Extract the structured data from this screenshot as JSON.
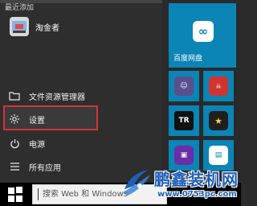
{
  "start_menu": {
    "recently_added_title": "最近添加",
    "recent_app": {
      "label": "淘金者",
      "icon": "game-app-icon"
    },
    "items": [
      {
        "label": "文件资源管理器",
        "icon": "folder-icon",
        "has_arrow": true
      },
      {
        "label": "设置",
        "icon": "gear-icon",
        "highlighted": true
      },
      {
        "label": "电源",
        "icon": "power-icon"
      },
      {
        "label": "所有应用",
        "icon": "list-icon"
      }
    ]
  },
  "tiles": {
    "big_tile": {
      "label": "百度网盘",
      "icon": "cloud-icon",
      "color": "#0b84b6"
    },
    "small_tiles": [
      {
        "icon": "game-character-icon",
        "glyph": "☺"
      },
      {
        "icon": "game-emblem-icon",
        "glyph": "☠"
      },
      {
        "icon": "tr-app-icon",
        "glyph": "TR"
      },
      {
        "icon": "dark-app-icon",
        "glyph": "★"
      },
      {
        "icon": "chip-app-icon",
        "glyph": "▣"
      },
      {
        "icon": "film-app-icon",
        "glyph": "▤"
      }
    ]
  },
  "taskbar": {
    "search_placeholder": "搜索 Web 和 Windows"
  },
  "watermark": {
    "text_cn": "鹏鑫装机网",
    "url": "www.0753pc.com"
  },
  "colors": {
    "highlight_border": "#d1333a",
    "tile_blue": "#0b84b6",
    "watermark_blue": "#1f5fb8"
  }
}
